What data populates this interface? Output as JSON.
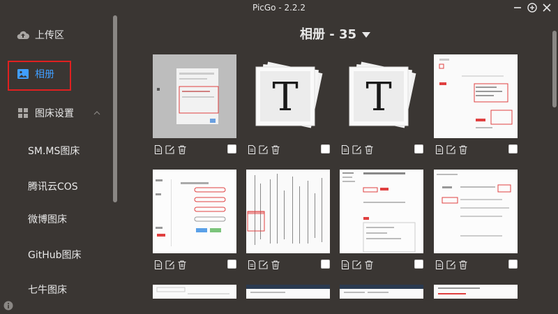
{
  "window": {
    "title": "PicGo - 2.2.2"
  },
  "sidebar": {
    "upload": {
      "label": "上传区",
      "icon": "cloud-upload-icon"
    },
    "gallery": {
      "label": "相册",
      "icon": "image-icon"
    },
    "settings": {
      "label": "图床设置",
      "icon": "grid-icon"
    },
    "hosts": [
      {
        "label": "SM.MS图床"
      },
      {
        "label": "腾讯云COS"
      },
      {
        "label": "微博图床"
      },
      {
        "label": "GitHub图床"
      },
      {
        "label": "七牛图床"
      }
    ]
  },
  "gallery": {
    "title": "相册 - 35",
    "items": [
      {
        "kind": "screenshot"
      },
      {
        "kind": "typora"
      },
      {
        "kind": "typora"
      },
      {
        "kind": "screenshot"
      },
      {
        "kind": "screenshot"
      },
      {
        "kind": "screenshot"
      },
      {
        "kind": "screenshot"
      },
      {
        "kind": "screenshot"
      }
    ]
  },
  "colors": {
    "accent": "#409eff",
    "highlight": "#e02020",
    "background": "#3a3633"
  }
}
